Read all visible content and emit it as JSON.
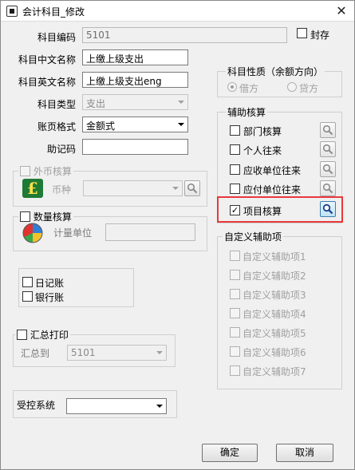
{
  "window": {
    "title": "会计科目_修改",
    "close_label": "✕"
  },
  "form": {
    "code": {
      "label": "科目编码",
      "value": "5101"
    },
    "sealed_label": "封存",
    "cn_name": {
      "label": "科目中文名称",
      "value": "上缴上级支出"
    },
    "en_name": {
      "label": "科目英文名称",
      "value": "上缴上级支出eng"
    },
    "type": {
      "label": "科目类型",
      "value": "支出"
    },
    "page_format": {
      "label": "账页格式",
      "value": "金额式"
    },
    "mnemonic": {
      "label": "助记码",
      "value": ""
    }
  },
  "foreign": {
    "caption": "外币核算",
    "currency_label": "币种",
    "currency_value": ""
  },
  "quantity": {
    "caption": "数量核算",
    "unit_label": "计量单位",
    "unit_value": ""
  },
  "journal": {
    "daybook_label": "日记账",
    "bank_label": "银行账"
  },
  "summary": {
    "caption": "汇总打印",
    "to_label": "汇总到",
    "to_value": "5101"
  },
  "controlled": {
    "label": "受控系统",
    "value": ""
  },
  "nature": {
    "caption": "科目性质（余额方向）",
    "debit": "借方",
    "credit": "贷方",
    "selected": "借方"
  },
  "auxiliary": {
    "caption": "辅助核算",
    "items": [
      {
        "label": "部门核算",
        "checked": false
      },
      {
        "label": "个人往来",
        "checked": false
      },
      {
        "label": "应收单位往来",
        "checked": false
      },
      {
        "label": "应付单位往来",
        "checked": false
      },
      {
        "label": "项目核算",
        "checked": true
      }
    ]
  },
  "custom": {
    "caption": "自定义辅助项",
    "items": [
      "自定义辅助项1",
      "自定义辅助项2",
      "自定义辅助项3",
      "自定义辅助项4",
      "自定义辅助项5",
      "自定义辅助项6",
      "自定义辅助项7"
    ]
  },
  "buttons": {
    "ok": "确定",
    "cancel": "取消"
  },
  "colors": {
    "highlight": "#e8393c"
  },
  "icons": {
    "currency": "pound-icon",
    "quantity": "pie-chart-icon",
    "lookup": "magnifier-icon"
  }
}
